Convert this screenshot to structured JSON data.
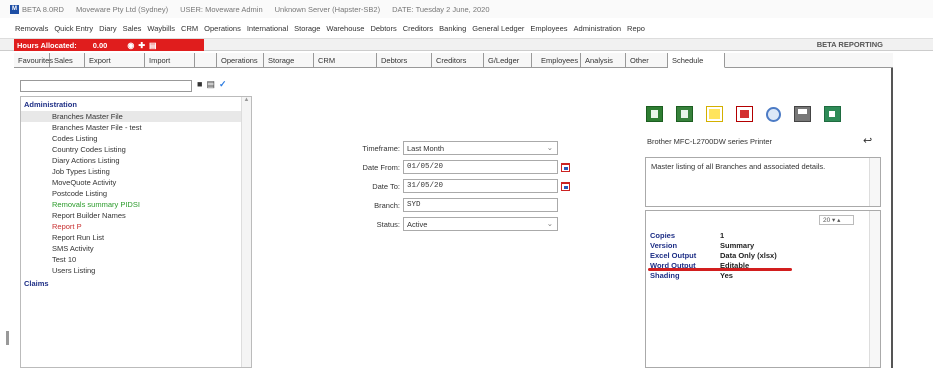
{
  "titlebar": {
    "app": "BETA 8.0RD",
    "company": "Moveware Pty Ltd (Sydney)",
    "user": "USER: Moveware Admin",
    "server": "Unknown Server (Hapster-SB2)",
    "date": "DATE: Tuesday 2 June, 2020"
  },
  "menu": [
    "Removals",
    "Quick Entry",
    "Diary",
    "Sales",
    "Waybills",
    "CRM",
    "Operations",
    "International",
    "Storage",
    "Warehouse",
    "Debtors",
    "Creditors",
    "Banking",
    "General Ledger",
    "Employees",
    "Administration",
    "Repo"
  ],
  "status": {
    "hours_label": "Hours Allocated:",
    "hours_value": "0.00",
    "beta_reporting": "BETA REPORTING"
  },
  "tabs": [
    "Favourites",
    "Sales",
    "Export",
    "Import",
    "Operations",
    "Storage",
    "CRM",
    "Debtors",
    "Creditors",
    "G/Ledger",
    "Employees",
    "Analysis",
    "Other",
    "Schedule"
  ],
  "tree": {
    "group1": "Administration",
    "items": [
      {
        "label": "Branches Master File",
        "style": "sel"
      },
      {
        "label": "Branches Master File - test",
        "style": ""
      },
      {
        "label": "Codes Listing",
        "style": ""
      },
      {
        "label": "Country Codes Listing",
        "style": ""
      },
      {
        "label": "Diary Actions Listing",
        "style": ""
      },
      {
        "label": "Job Types Listing",
        "style": ""
      },
      {
        "label": "MoveQuote Activity",
        "style": ""
      },
      {
        "label": "Postcode Listing",
        "style": ""
      },
      {
        "label": "Removals summary PIDSI",
        "style": "green"
      },
      {
        "label": "Report Builder Names",
        "style": ""
      },
      {
        "label": "Report P",
        "style": "red"
      },
      {
        "label": "Report Run List",
        "style": ""
      },
      {
        "label": "SMS Activity",
        "style": ""
      },
      {
        "label": "Test 10",
        "style": ""
      },
      {
        "label": "Users Listing",
        "style": ""
      }
    ],
    "group2": "Claims"
  },
  "form": {
    "timeframe_label": "Timeframe:",
    "timeframe_value": "Last Month",
    "date_from_label": "Date From:",
    "date_from_value": "01/05/20",
    "date_to_label": "Date To:",
    "date_to_value": "31/05/20",
    "branch_label": "Branch:",
    "branch_value": "SYD",
    "status_label": "Status:",
    "status_value": "Active"
  },
  "printer": "Brother MFC-L2700DW series Printer",
  "description": "Master listing of all Branches and associated details.",
  "zoom": "20",
  "props": [
    {
      "key": "Copies",
      "value": "1"
    },
    {
      "key": "Version",
      "value": "Summary"
    },
    {
      "key": "Excel Output",
      "value": "Data Only (xlsx)"
    },
    {
      "key": "Word Output",
      "value": "Editable"
    },
    {
      "key": "Shading",
      "value": "Yes"
    }
  ],
  "colors": {
    "hours_bg": "#e01d1d",
    "group_blue": "#1e2f86",
    "highlight_red": "#d21e1e"
  }
}
